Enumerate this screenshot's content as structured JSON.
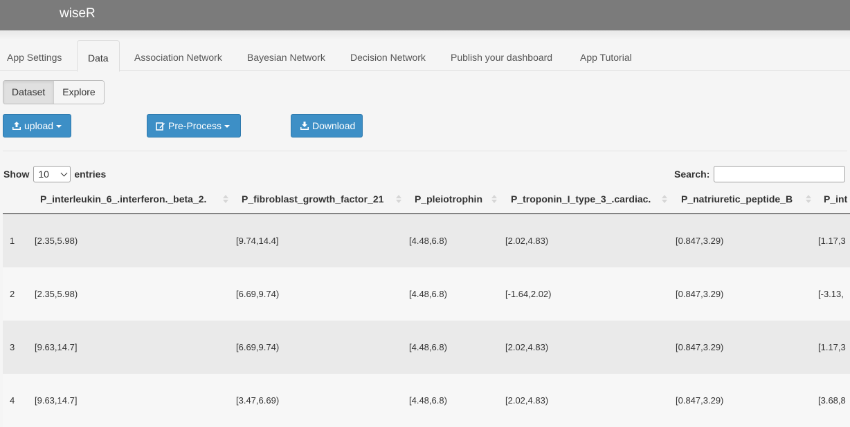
{
  "app": {
    "brand": "wiseR"
  },
  "tabs": [
    {
      "label": "App Settings"
    },
    {
      "label": "Data"
    },
    {
      "label": "Association Network"
    },
    {
      "label": "Bayesian Network"
    },
    {
      "label": "Decision Network"
    },
    {
      "label": "Publish your dashboard"
    },
    {
      "label": "App Tutorial"
    }
  ],
  "subtabs": [
    {
      "label": "Dataset"
    },
    {
      "label": "Explore"
    }
  ],
  "buttons": {
    "upload": "upload",
    "preprocess": "Pre-Process",
    "download": "Download"
  },
  "entries": {
    "show": "Show",
    "value": "10",
    "suffix": "entries"
  },
  "search": {
    "label": "Search:"
  },
  "table": {
    "columns": [
      "P_interleukin_6_.interferon._beta_2.",
      "P_fibroblast_growth_factor_21",
      "P_pleiotrophin",
      "P_troponin_I_type_3_.cardiac.",
      "P_natriuretic_peptide_B",
      "P_int"
    ],
    "rows": [
      {
        "idx": "1",
        "c1": "[2.35,5.98)",
        "c2": "[9.74,14.4]",
        "c3": "[4.48,6.8)",
        "c4": "[2.02,4.83)",
        "c5": "[0.847,3.29)",
        "c6": "[1.17,3"
      },
      {
        "idx": "2",
        "c1": "[2.35,5.98)",
        "c2": "[6.69,9.74)",
        "c3": "[4.48,6.8)",
        "c4": "[-1.64,2.02)",
        "c5": "[0.847,3.29)",
        "c6": "[-3.13,"
      },
      {
        "idx": "3",
        "c1": "[9.63,14.7]",
        "c2": "[6.69,9.74)",
        "c3": "[4.48,6.8)",
        "c4": "[2.02,4.83)",
        "c5": "[0.847,3.29)",
        "c6": "[1.17,3"
      },
      {
        "idx": "4",
        "c1": "[9.63,14.7]",
        "c2": "[3.47,6.69)",
        "c3": "[4.48,6.8)",
        "c4": "[2.02,4.83)",
        "c5": "[0.847,3.29)",
        "c6": "[3.68,8"
      }
    ]
  }
}
